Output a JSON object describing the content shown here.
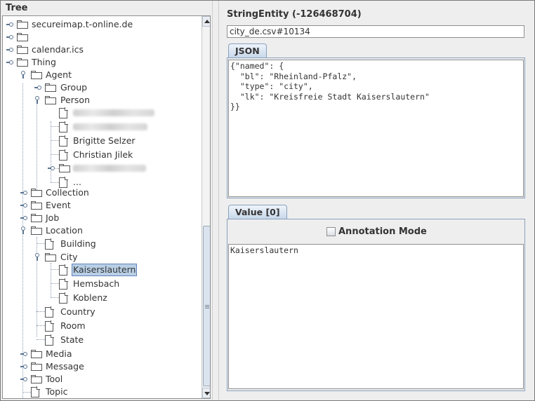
{
  "tree": {
    "title": "Tree",
    "nodes": [
      {
        "label": "secureimap.t-online.de"
      },
      {
        "label": ""
      },
      {
        "label": "calendar.ics"
      },
      {
        "label": "Thing"
      },
      {
        "label": "Agent"
      },
      {
        "label": "Group"
      },
      {
        "label": "Person"
      },
      {
        "label": ""
      },
      {
        "label": ""
      },
      {
        "label": "Brigitte Selzer"
      },
      {
        "label": "Christian Jilek"
      },
      {
        "label": ""
      },
      {
        "label": "..."
      },
      {
        "label": "Collection"
      },
      {
        "label": "Event"
      },
      {
        "label": "Job"
      },
      {
        "label": "Location"
      },
      {
        "label": "Building"
      },
      {
        "label": "City"
      },
      {
        "label": "Kaiserslautern"
      },
      {
        "label": "Hemsbach"
      },
      {
        "label": "Koblenz"
      },
      {
        "label": "Country"
      },
      {
        "label": "Room"
      },
      {
        "label": "State"
      },
      {
        "label": "Media"
      },
      {
        "label": "Message"
      },
      {
        "label": "Tool"
      },
      {
        "label": "Topic"
      }
    ]
  },
  "entity": {
    "title": "StringEntity (-126468704)",
    "file_ref": "city_de.csv#10134"
  },
  "json_tab": {
    "label": "JSON",
    "content": "{\"named\": {\n  \"bl\": \"Rheinland-Pfalz\",\n  \"type\": \"city\",\n  \"lk\": \"Kreisfreie Stadt Kaiserslautern\"\n}}"
  },
  "value_tab": {
    "label": "Value [0]",
    "annotation_mode_label": "Annotation Mode",
    "annotation_mode_checked": false,
    "content": "Kaiserslautern"
  }
}
